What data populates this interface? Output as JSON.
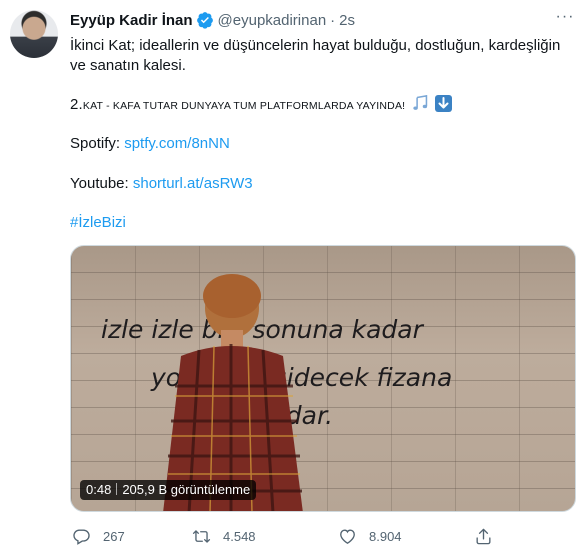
{
  "tweet": {
    "author_name": "Eyyüp Kadir İnan",
    "handle": "@eyupkadirinan",
    "separator": "·",
    "time": "2s",
    "more": "···",
    "line1": "İkinci Kat; ideallerin ve düşüncelerin hayat bulduğu, dostluğun, kardeşliğin",
    "line2": "ve sanatın kalesi.",
    "announce_num": "2.",
    "announce_text": "KAT - KAFA TUTAR DUNYAYA TUM PLATFORMLARDA YAYINDA!",
    "spotify_label": "Spotify:",
    "spotify_link": "sptfy.com/8nNN",
    "youtube_label": "Youtube:",
    "youtube_link": "shorturl.at/asRW3",
    "hashtag": "#İzleBizi"
  },
  "video": {
    "wall_text_line1": "izle izle bizi sonuna kadar",
    "wall_text_line2": "yol olsun gidecek fizana",
    "wall_text_line3": "kadar.",
    "duration": "0:48",
    "views": "205,9 B görüntülenme"
  },
  "actions": {
    "replies": "267",
    "retweets": "4.548",
    "likes": "8.904"
  },
  "icons": {
    "verified": "verified-badge-icon",
    "more": "more-icon",
    "reply": "reply-icon",
    "retweet": "retweet-icon",
    "like": "heart-icon",
    "share": "share-icon",
    "notes": "musical-notes-emoji",
    "down": "down-arrow-emoji"
  },
  "colors": {
    "link": "#1d9bf0",
    "text": "#0f1419",
    "muted": "#536471"
  }
}
